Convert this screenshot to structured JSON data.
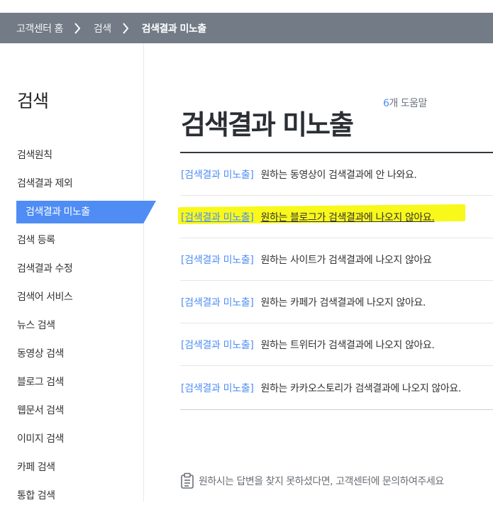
{
  "breadcrumb": {
    "items": [
      "고객센터 홈",
      "검색",
      "검색결과 미노출"
    ]
  },
  "sidebar": {
    "title": "검색",
    "items": [
      {
        "label": "검색원칙"
      },
      {
        "label": "검색결과 제외"
      },
      {
        "label": "검색결과 미노출",
        "active": true
      },
      {
        "label": "검색 등록"
      },
      {
        "label": "검색결과 수정"
      },
      {
        "label": "검색어 서비스"
      },
      {
        "label": "뉴스 검색"
      },
      {
        "label": "동영상 검색"
      },
      {
        "label": "블로그 검색"
      },
      {
        "label": "웹문서 검색"
      },
      {
        "label": "이미지 검색"
      },
      {
        "label": "카페 검색"
      },
      {
        "label": "통합 검색"
      }
    ]
  },
  "main": {
    "title": "검색결과 미노출",
    "count_num": "6",
    "count_text": "개 도움말",
    "results": [
      {
        "category": "[검색결과 미노출]",
        "title": "원하는 동영상이 검색결과에 안 나와요."
      },
      {
        "category": "[검색결과 미노출]",
        "title": "원하는 블로그가 검색결과에 나오지 않아요.",
        "highlighted": true
      },
      {
        "category": "[검색결과 미노출]",
        "title": "원하는 사이트가 검색결과에 나오지 않아요"
      },
      {
        "category": "[검색결과 미노출]",
        "title": "원하는 카페가 검색결과에 나오지 않아요."
      },
      {
        "category": "[검색결과 미노출]",
        "title": "원하는 트위터가 검색결과에 나오지 않아요."
      },
      {
        "category": "[검색결과 미노출]",
        "title": "원하는 카카오스토리가 검색결과에 나오지 않아요."
      }
    ]
  },
  "footer": {
    "icon": "clipboard-icon",
    "text": "원하시는 답변을 찾지 못하셨다면, 고객센터에 문의하여주세요"
  },
  "colors": {
    "breadcrumb_bg": "#727b86",
    "accent": "#4f8df5",
    "highlight": "#f8f81a"
  }
}
